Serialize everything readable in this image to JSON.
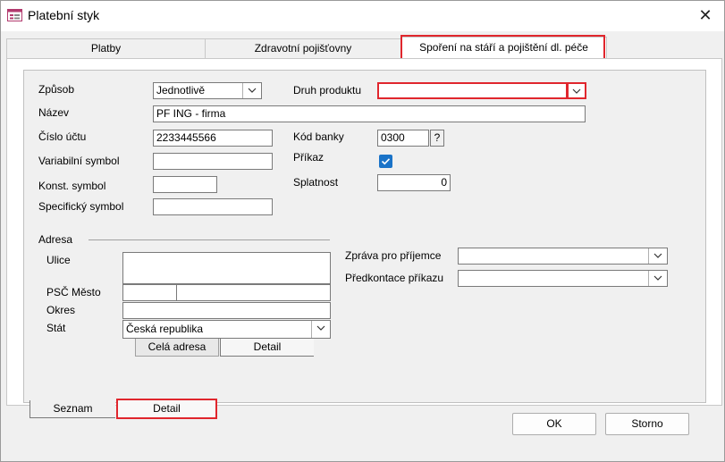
{
  "window": {
    "title": "Platební styk",
    "close_glyph": "✕",
    "icon": "form-icon"
  },
  "tabs": [
    {
      "label": "Platby"
    },
    {
      "label": "Zdravotní pojišťovny"
    },
    {
      "label": "Spoření na stáří a pojištění dl. péče"
    }
  ],
  "form": {
    "zpusob_label": "Způsob",
    "zpusob_value": "Jednotlivě",
    "druh_produktu_label": "Druh produktu",
    "druh_produktu_value": "",
    "nazev_label": "Název",
    "nazev_value": "PF ING - firma",
    "cislo_uctu_label": "Číslo účtu",
    "cislo_uctu_value": "2233445566",
    "kod_banky_label": "Kód banky",
    "kod_banky_value": "0300",
    "kod_banky_help": "?",
    "variabilni_label": "Variabilní symbol",
    "variabilni_value": "",
    "prikaz_label": "Příkaz",
    "prikaz_checked": true,
    "konst_label": "Konst. symbol",
    "konst_value": "",
    "splatnost_label": "Splatnost",
    "splatnost_value": "0",
    "specificky_label": "Specifický symbol",
    "specificky_value": ""
  },
  "adresa": {
    "section_label": "Adresa",
    "ulice_label": "Ulice",
    "ulice_value": "",
    "psc_mesto_label": "PSČ Město",
    "psc_value": "",
    "mesto_value": "",
    "okres_label": "Okres",
    "okres_value": "",
    "stat_label": "Stát",
    "stat_value": "Česká republika",
    "subtabs": [
      {
        "label": "Celá adresa"
      },
      {
        "label": "Detail"
      }
    ]
  },
  "zprava": {
    "zprava_label": "Zpráva pro příjemce",
    "zprava_value": "",
    "predkontace_label": "Předkontace příkazu",
    "predkontace_value": ""
  },
  "bottom_tabs": [
    {
      "label": "Seznam"
    },
    {
      "label": "Detail"
    }
  ],
  "buttons": {
    "ok": "OK",
    "cancel": "Storno"
  },
  "colors": {
    "highlight": "#e0262d",
    "checkbox": "#1a73c8"
  }
}
